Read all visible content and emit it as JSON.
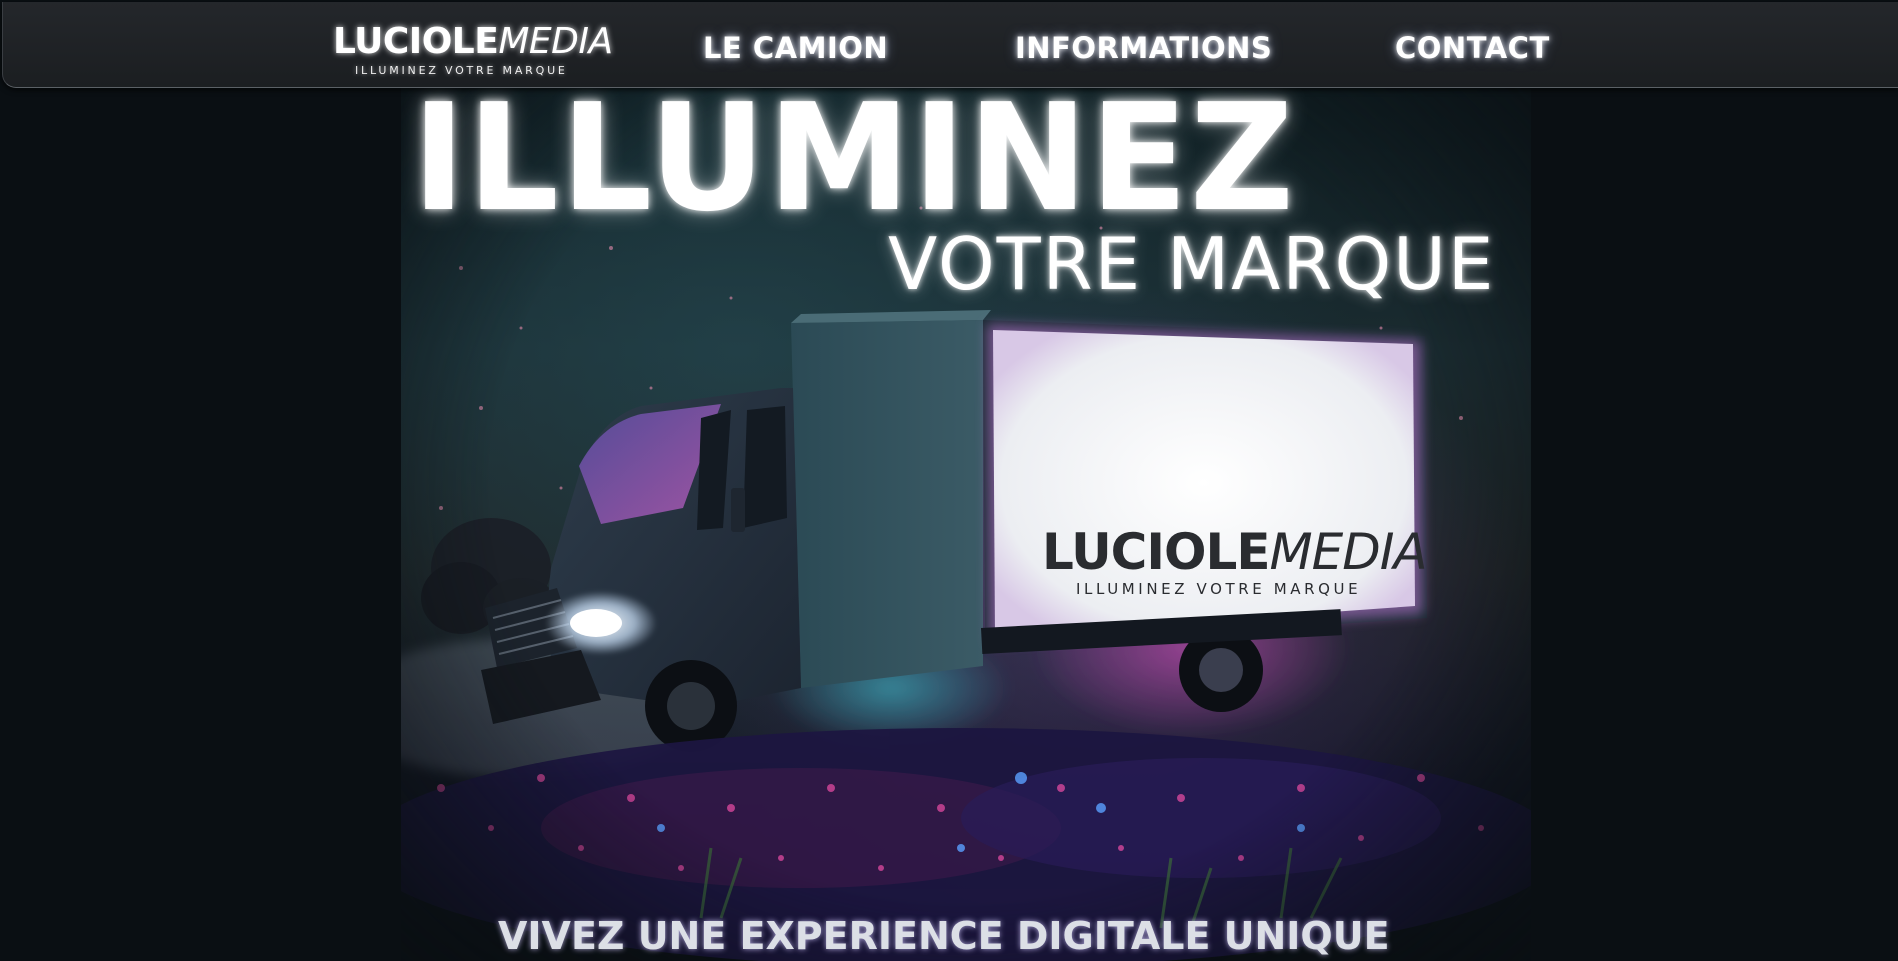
{
  "brand": {
    "name_bold": "LUCIOLE",
    "name_italic": "MEDIA",
    "slogan": "ILLUMINEZ VOTRE MARQUE"
  },
  "nav": {
    "items": [
      {
        "label": "LE CAMION"
      },
      {
        "label": "INFORMATIONS"
      },
      {
        "label": "CONTACT"
      }
    ]
  },
  "hero": {
    "headline_main": "ILLUMINEZ",
    "headline_sub": "VOTRE MARQUE",
    "tagline": "VIVEZ UNE EXPERIENCE DIGITALE UNIQUE",
    "truck_screen": {
      "name_bold": "LUCIOLE",
      "name_italic": "MEDIA",
      "slogan": "ILLUMINEZ VOTRE MARQUE"
    }
  },
  "colors": {
    "background": "#0a0f13",
    "navbar": "#1f2226",
    "text_glow": "#ffffff",
    "screen_glow": "#c07ad8",
    "accent_cyan": "#3fb6c8",
    "accent_pink": "#d04a9a"
  }
}
